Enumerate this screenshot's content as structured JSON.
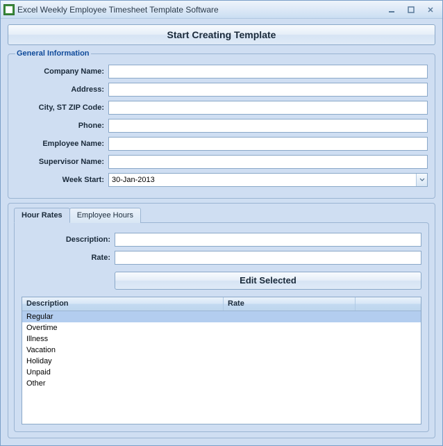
{
  "window": {
    "title": "Excel Weekly Employee Timesheet Template Software"
  },
  "buttons": {
    "start_creating": "Start Creating Template",
    "edit_selected": "Edit Selected"
  },
  "general": {
    "legend": "General Information",
    "labels": {
      "company": "Company Name:",
      "address": "Address:",
      "cityzip": "City, ST  ZIP Code:",
      "phone": "Phone:",
      "employee": "Employee Name:",
      "supervisor": "Supervisor Name:",
      "week_start": "Week Start:"
    },
    "values": {
      "company": "",
      "address": "",
      "cityzip": "",
      "phone": "",
      "employee": "",
      "supervisor": "",
      "week_start": "30-Jan-2013"
    }
  },
  "tabs": {
    "hour_rates": "Hour Rates",
    "employee_hours": "Employee Hours"
  },
  "rates": {
    "labels": {
      "description": "Description:",
      "rate": "Rate:"
    },
    "values": {
      "description": "",
      "rate": ""
    },
    "columns": {
      "description": "Description",
      "rate": "Rate"
    },
    "rows": [
      {
        "description": "Regular",
        "rate": "",
        "selected": true
      },
      {
        "description": "Overtime",
        "rate": ""
      },
      {
        "description": "Illness",
        "rate": ""
      },
      {
        "description": "Vacation",
        "rate": ""
      },
      {
        "description": "Holiday",
        "rate": ""
      },
      {
        "description": "Unpaid",
        "rate": ""
      },
      {
        "description": "Other",
        "rate": ""
      }
    ]
  }
}
